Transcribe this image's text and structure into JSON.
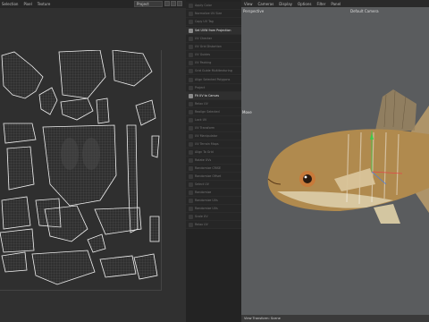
{
  "uv_editor": {
    "menu": [
      "Selection",
      "Pixel",
      "Texture"
    ],
    "projection_select": "Project"
  },
  "command_panel": {
    "items": [
      {
        "label": "Apply Color",
        "active": false
      },
      {
        "label": "Normalize UV Size",
        "active": false
      },
      {
        "label": "Copy UV Tag",
        "active": false
      },
      {
        "label": "Set UVW from Projection",
        "active": true
      },
      {
        "label": "UV Checker",
        "active": false
      },
      {
        "label": "UV Grid Distortion",
        "active": false
      },
      {
        "label": "UV Guides",
        "active": false
      },
      {
        "label": "UV Packing",
        "active": false
      },
      {
        "label": "Grid Guide Multitexturing",
        "active": false
      },
      {
        "label": "Align Selected Polygons",
        "active": false
      },
      {
        "label": "Project",
        "active": false
      },
      {
        "label": "Fit UV to Canvas",
        "active": true
      },
      {
        "label": "Relax UV",
        "active": false
      },
      {
        "label": "Realign Selected",
        "active": false
      },
      {
        "label": "Lock UV",
        "active": false
      },
      {
        "label": "UV Transform",
        "active": false
      },
      {
        "label": "UV Manipulator",
        "active": false
      },
      {
        "label": "UV Terrain Maps",
        "active": false
      },
      {
        "label": "Align To Grid",
        "active": false
      },
      {
        "label": "Rotate UVs",
        "active": false
      },
      {
        "label": "Randomize CRISE",
        "active": false
      },
      {
        "label": "Randomize Offset",
        "active": false
      },
      {
        "label": "Select UV",
        "active": false
      },
      {
        "label": "Randomize",
        "active": false
      },
      {
        "label": "Randomize UVs",
        "active": false
      },
      {
        "label": "Randomize UVs",
        "active": false
      },
      {
        "label": "Scale UV",
        "active": false
      },
      {
        "label": "Relax UV",
        "active": false
      },
      {
        "label": "Resize",
        "active": false
      },
      {
        "label": "Reflow",
        "active": false
      }
    ]
  },
  "viewport": {
    "menu": [
      "View",
      "Cameras",
      "Display",
      "Options",
      "Filter",
      "Panel"
    ],
    "view_name": "Perspective",
    "camera_name": "Default Camera",
    "tool_label": "Move",
    "footer": "View Transform: Scene",
    "fish_colors": {
      "body": "#b08a4e",
      "belly": "#d8c7a0",
      "fin": "#b79a6a",
      "eye": "#c87a3a"
    }
  }
}
